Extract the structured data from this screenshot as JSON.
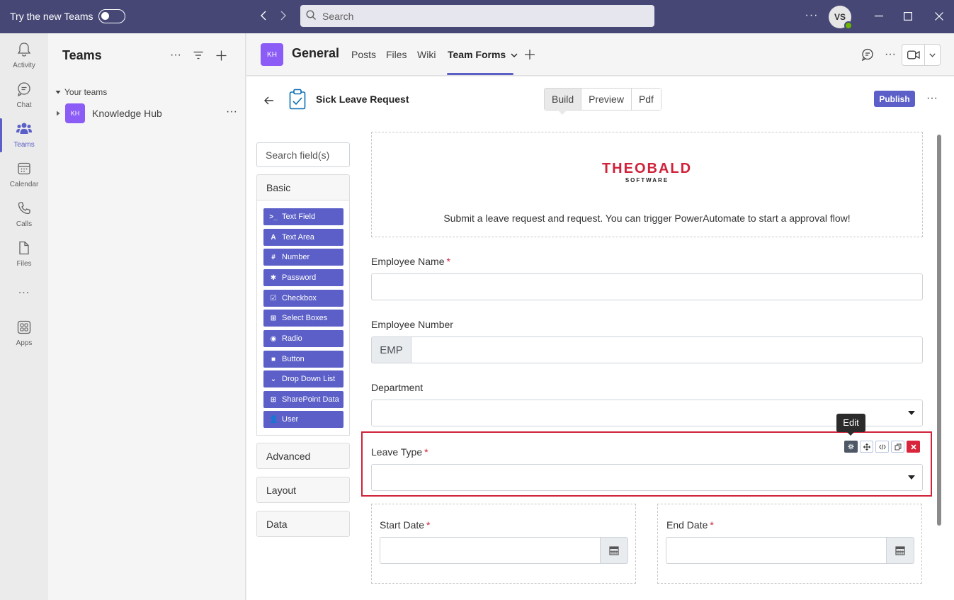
{
  "titlebar": {
    "try_new_teams": "Try the new Teams",
    "search_placeholder": "Search",
    "user_initials": "VS"
  },
  "rail": {
    "items": [
      {
        "label": "Activity"
      },
      {
        "label": "Chat"
      },
      {
        "label": "Teams"
      },
      {
        "label": "Calendar"
      },
      {
        "label": "Calls"
      },
      {
        "label": "Files"
      },
      {
        "label": "Apps"
      }
    ],
    "more": "..."
  },
  "teams_panel": {
    "title": "Teams",
    "section": "Your teams",
    "teams": [
      {
        "initials": "KH",
        "name": "Knowledge Hub"
      }
    ]
  },
  "channel": {
    "initials": "KH",
    "name": "General",
    "tabs": [
      "Posts",
      "Files",
      "Wiki",
      "Team Forms"
    ]
  },
  "form_builder": {
    "title": "Sick Leave Request",
    "modes": [
      "Build",
      "Preview",
      "Pdf"
    ],
    "publish": "Publish",
    "search_fields_placeholder": "Search field(s)",
    "groups": {
      "basic": "Basic",
      "advanced": "Advanced",
      "layout": "Layout",
      "data": "Data"
    },
    "components": [
      {
        "icon": ">_",
        "label": "Text Field"
      },
      {
        "icon": "A",
        "label": "Text Area"
      },
      {
        "icon": "#",
        "label": "Number"
      },
      {
        "icon": "✱",
        "label": "Password"
      },
      {
        "icon": "☑",
        "label": "Checkbox"
      },
      {
        "icon": "⊞",
        "label": "Select Boxes"
      },
      {
        "icon": "◉",
        "label": "Radio"
      },
      {
        "icon": "■",
        "label": "Button"
      },
      {
        "icon": "⌄",
        "label": "Drop Down List"
      },
      {
        "icon": "⊞",
        "label": "SharePoint Data"
      },
      {
        "icon": "👤",
        "label": "User"
      }
    ]
  },
  "canvas": {
    "logo_main": "THEOBALD",
    "logo_sub": "SOFTWARE",
    "description": "Submit a leave request and request. You can trigger PowerAutomate to start a approval flow!",
    "fields": {
      "employee_name": "Employee Name",
      "employee_number": "Employee Number",
      "employee_number_prefix": "EMP",
      "department": "Department",
      "leave_type": "Leave Type",
      "start_date": "Start Date",
      "end_date": "End Date"
    },
    "required_marker": "*",
    "edit_tooltip": "Edit"
  },
  "colors": {
    "title_bar": "#464775",
    "accent": "#5b5fc7",
    "selected_border": "#d0223a",
    "logo_red": "#d0223a"
  }
}
